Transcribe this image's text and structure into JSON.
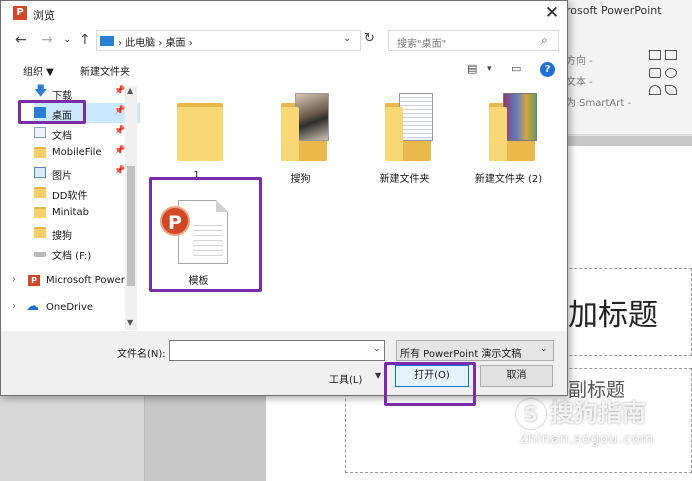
{
  "dialog": {
    "title": "浏览",
    "app_icon": "P",
    "close": "✕"
  },
  "nav": {
    "back": "←",
    "forward": "→",
    "recent": "⌄",
    "up": "↑",
    "address_path": "›  此电脑  ›  桌面  ›",
    "address_dropdown": "⌄",
    "refresh": "↻",
    "search_placeholder": "搜索\"桌面\"",
    "search_icon": "⌕"
  },
  "toolbar": {
    "organize": "组织 ▼",
    "new_folder": "新建文件夹",
    "view_icon": "▤",
    "view_dropdown": "▾",
    "preview_icon": "▭",
    "help": "?"
  },
  "navpane": {
    "items": [
      {
        "label": "下载",
        "icon": "download-icon",
        "pinned": true
      },
      {
        "label": "桌面",
        "icon": "desktop-icon",
        "pinned": true
      },
      {
        "label": "文档",
        "icon": "document-icon",
        "pinned": true
      },
      {
        "label": "MobileFile",
        "icon": "folder-icon",
        "pinned": true
      },
      {
        "label": "图片",
        "icon": "picture-icon",
        "pinned": true
      },
      {
        "label": "DD软件",
        "icon": "folder-icon",
        "pinned": false
      },
      {
        "label": "Minitab",
        "icon": "folder-icon",
        "pinned": false
      },
      {
        "label": "搜狗",
        "icon": "folder-icon",
        "pinned": false
      },
      {
        "label": "文档 (F:)",
        "icon": "drive-icon",
        "pinned": false
      },
      {
        "label": "Microsoft Power",
        "icon": "powerpoint-icon",
        "pinned": false
      },
      {
        "label": "OneDrive",
        "icon": "onedrive-icon",
        "pinned": false
      }
    ],
    "pin_glyph": "📌",
    "expand_glyph": "›"
  },
  "files": [
    {
      "name": "1",
      "kind": "folder"
    },
    {
      "name": "搜狗",
      "kind": "folder-photo"
    },
    {
      "name": "新建文件夹",
      "kind": "folder-doc"
    },
    {
      "name": "新建文件夹 (2)",
      "kind": "folder-book"
    },
    {
      "name": "模板",
      "kind": "pptx"
    }
  ],
  "bottom": {
    "filename_label": "文件名(N):",
    "filename_value": "",
    "filetype": "所有 PowerPoint 演示文稿",
    "tools": "工具(L)",
    "open": "打开(O)",
    "cancel": "取消",
    "dropdown": "⌄"
  },
  "background": {
    "app_title": "rosoft PowerPoint",
    "ribbon_text_1": "方向 -",
    "ribbon_text_2": "文本 -",
    "ribbon_text_3": "为 SmartArt -",
    "slide_title_placeholder": "加标题",
    "slide_subtitle_placeholder": "副标题",
    "watermark": "搜狗指南",
    "watermark_logo": "S",
    "watermark_url": "zhinan.sogou.com"
  },
  "colors": {
    "highlight": "#7a2ca8",
    "accent": "#0078d7",
    "powerpoint": "#d24726"
  }
}
